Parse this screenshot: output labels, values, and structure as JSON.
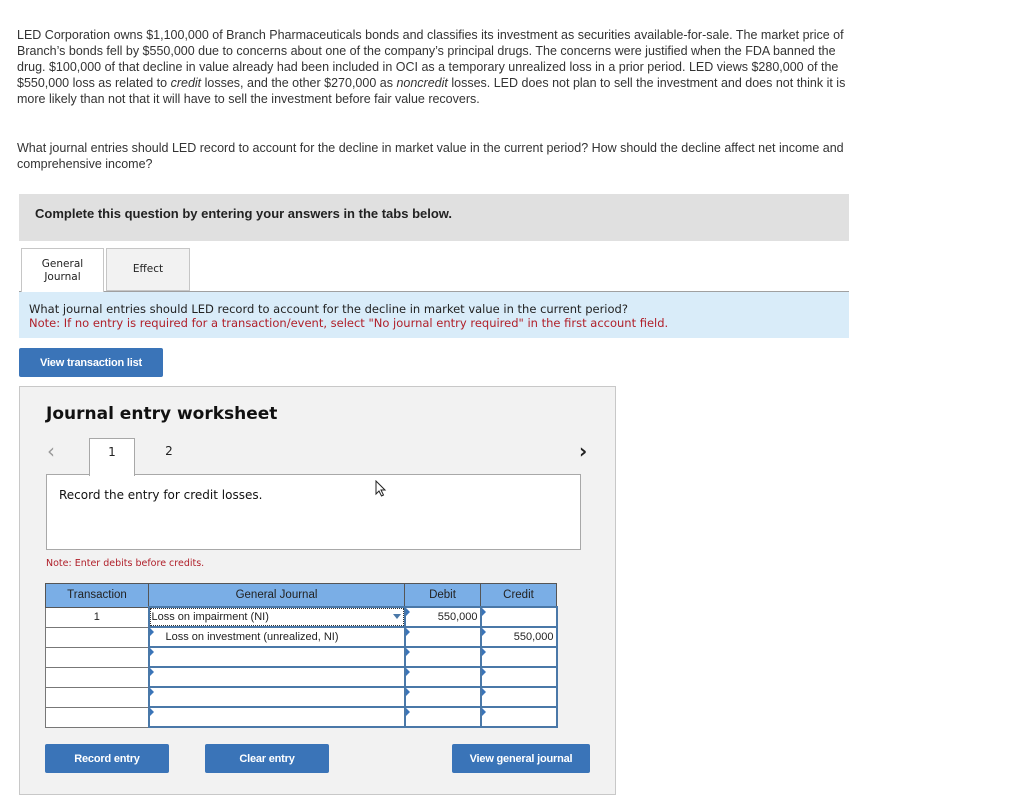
{
  "question": {
    "paragraph1_parts": [
      "LED Corporation owns $1,100,000 of Branch Pharmaceuticals bonds and classifies its investment as securities available-for-sale. The market price of Branch’s bonds fell by $550,000 due to concerns about one of the company’s principal drugs. The concerns were justified when the FDA banned the drug. $100,000 of that decline in value already had been included in OCI as a temporary unrealized loss in a prior period. LED views $280,000 of the $550,000 loss as related to ",
      "credit",
      " losses, and the other $270,000 as ",
      "noncredit",
      " losses. LED does not plan to sell the investment and does not think it is more likely than not that it will have to sell the investment before fair value recovers."
    ],
    "paragraph2": "What journal entries should LED record to account for the decline in market value in the current period? How should the decline affect net income and comprehensive income?"
  },
  "banner": "Complete this question by entering your answers in the tabs below.",
  "tabs": [
    {
      "label": "General Journal",
      "active": true
    },
    {
      "label": "Effect",
      "active": false
    }
  ],
  "info": {
    "line1": "What journal entries should LED record to account for the decline in market value in the current period?",
    "line2": "Note: If no entry is required for a transaction/event, select \"No journal entry required\" in the first account field."
  },
  "view_transaction_list": "View transaction list",
  "worksheet": {
    "title": "Journal entry worksheet",
    "prev_icon": "‹",
    "next_icon": "›",
    "entry_tabs": [
      "1",
      "2"
    ],
    "active_entry": "1",
    "description": "Record the entry for credit losses.",
    "note": "Note: Enter debits before credits.",
    "headers": {
      "transaction": "Transaction",
      "account": "General Journal",
      "debit": "Debit",
      "credit": "Credit"
    },
    "rows": [
      {
        "transaction": "1",
        "account": "Loss on impairment (NI)",
        "debit": "550,000",
        "credit": "",
        "indent": false,
        "selected": true
      },
      {
        "transaction": "",
        "account": "Loss on investment (unrealized, NI)",
        "debit": "",
        "credit": "550,000",
        "indent": true,
        "selected": false
      },
      {
        "transaction": "",
        "account": "",
        "debit": "",
        "credit": "",
        "indent": false,
        "selected": false
      },
      {
        "transaction": "",
        "account": "",
        "debit": "",
        "credit": "",
        "indent": false,
        "selected": false
      },
      {
        "transaction": "",
        "account": "",
        "debit": "",
        "credit": "",
        "indent": false,
        "selected": false
      },
      {
        "transaction": "",
        "account": "",
        "debit": "",
        "credit": "",
        "indent": false,
        "selected": false
      }
    ],
    "buttons": {
      "record": "Record entry",
      "clear": "Clear entry",
      "view_journal": "View general journal"
    }
  }
}
